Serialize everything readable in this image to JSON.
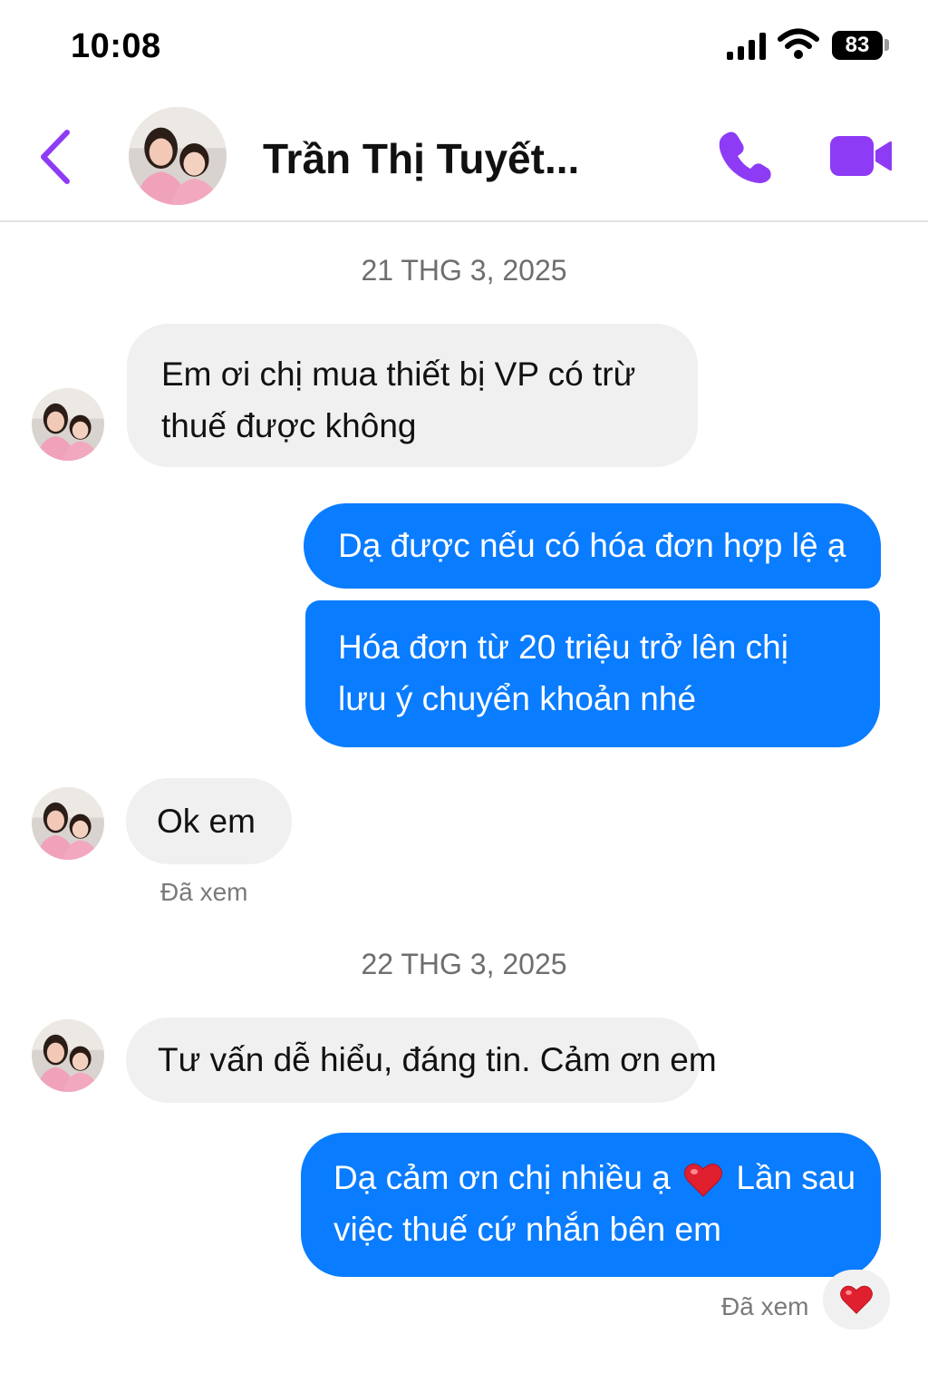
{
  "status_bar": {
    "time": "10:08",
    "battery": "83"
  },
  "header": {
    "contact_name": "Trần Thị Tuyết..."
  },
  "messages": {
    "date1": "21 THG 3, 2025",
    "m1": "Em ơi chị mua thiết bị VP có trừ thuế được không",
    "m2": "Dạ được nếu có hóa đơn hợp lệ ạ",
    "m3": "Hóa đơn từ 20 triệu trở lên chị lưu ý chuyển khoản nhé",
    "m4": "Ok em",
    "seen1": "Đã xem",
    "date2": "22 THG 3, 2025",
    "m5": "Tư vấn dễ hiểu, đáng tin. Cảm ơn em",
    "m6_a": "Dạ cảm ơn chị nhiều ạ",
    "m6_b": "Lần sau",
    "m6_c": "việc thuế cứ nhắn bên em",
    "seen2": "Đã xem"
  },
  "colors": {
    "accent": "#8e3bf5",
    "outgoing_bubble": "#0a7cff",
    "incoming_bubble": "#f0f0f0"
  },
  "icons": [
    "back-chevron-icon",
    "phone-icon",
    "video-camera-icon",
    "heart-icon"
  ]
}
